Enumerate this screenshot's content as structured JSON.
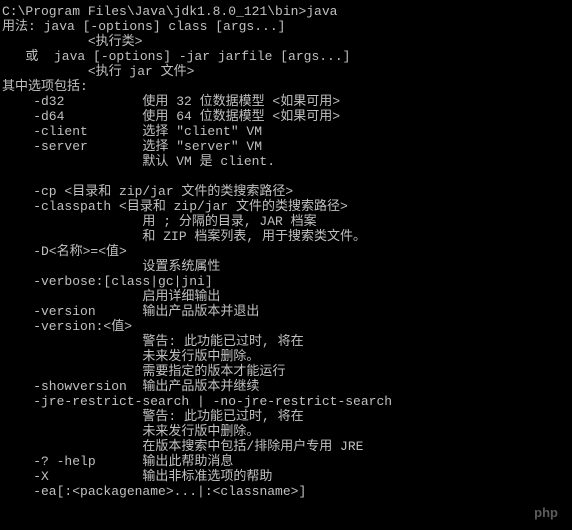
{
  "prompt": "C:\\Program Files\\Java\\jdk1.8.0_121\\bin>java",
  "lines": [
    "用法: java [-options] class [args...]",
    "           <执行类>",
    "   或  java [-options] -jar jarfile [args...]",
    "           <执行 jar 文件>",
    "其中选项包括:",
    "    -d32          使用 32 位数据模型 <如果可用>",
    "    -d64          使用 64 位数据模型 <如果可用>",
    "    -client       选择 \"client\" VM",
    "    -server       选择 \"server\" VM",
    "                  默认 VM 是 client.",
    "",
    "    -cp <目录和 zip/jar 文件的类搜索路径>",
    "    -classpath <目录和 zip/jar 文件的类搜索路径>",
    "                  用 ; 分隔的目录, JAR 档案",
    "                  和 ZIP 档案列表, 用于搜索类文件。",
    "    -D<名称>=<值>",
    "                  设置系统属性",
    "    -verbose:[class|gc|jni]",
    "                  启用详细输出",
    "    -version      输出产品版本并退出",
    "    -version:<值>",
    "                  警告: 此功能已过时, 将在",
    "                  未来发行版中删除。",
    "                  需要指定的版本才能运行",
    "    -showversion  输出产品版本并继续",
    "    -jre-restrict-search | -no-jre-restrict-search",
    "                  警告: 此功能已过时, 将在",
    "                  未来发行版中删除。",
    "                  在版本搜索中包括/排除用户专用 JRE",
    "    -? -help      输出此帮助消息",
    "    -X            输出非标准选项的帮助",
    "    -ea[:<packagename>...|:<classname>]"
  ],
  "watermark": "php"
}
